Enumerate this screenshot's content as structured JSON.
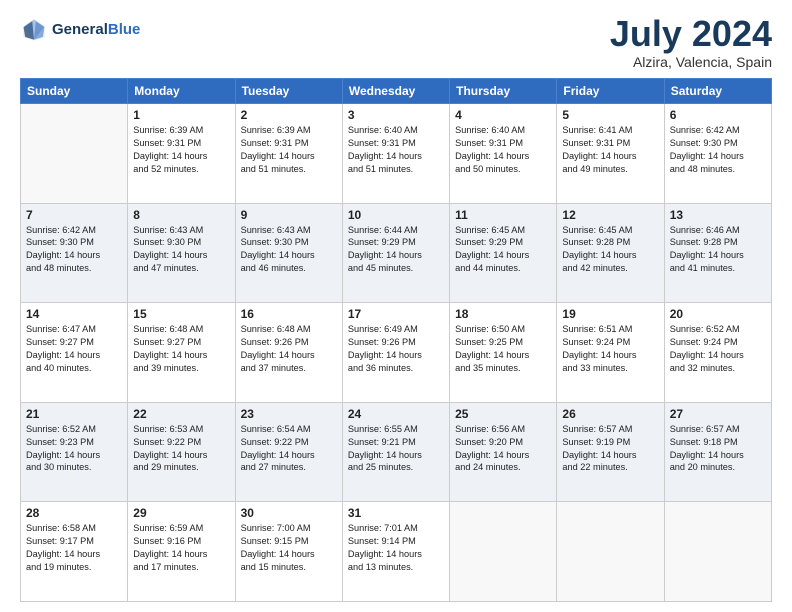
{
  "header": {
    "logo_line1": "General",
    "logo_line2": "Blue",
    "month_title": "July 2024",
    "location": "Alzira, Valencia, Spain"
  },
  "weekdays": [
    "Sunday",
    "Monday",
    "Tuesday",
    "Wednesday",
    "Thursday",
    "Friday",
    "Saturday"
  ],
  "weeks": [
    [
      {
        "day": "",
        "sunrise": "",
        "sunset": "",
        "daylight": ""
      },
      {
        "day": "1",
        "sunrise": "Sunrise: 6:39 AM",
        "sunset": "Sunset: 9:31 PM",
        "daylight": "Daylight: 14 hours and 52 minutes."
      },
      {
        "day": "2",
        "sunrise": "Sunrise: 6:39 AM",
        "sunset": "Sunset: 9:31 PM",
        "daylight": "Daylight: 14 hours and 51 minutes."
      },
      {
        "day": "3",
        "sunrise": "Sunrise: 6:40 AM",
        "sunset": "Sunset: 9:31 PM",
        "daylight": "Daylight: 14 hours and 51 minutes."
      },
      {
        "day": "4",
        "sunrise": "Sunrise: 6:40 AM",
        "sunset": "Sunset: 9:31 PM",
        "daylight": "Daylight: 14 hours and 50 minutes."
      },
      {
        "day": "5",
        "sunrise": "Sunrise: 6:41 AM",
        "sunset": "Sunset: 9:31 PM",
        "daylight": "Daylight: 14 hours and 49 minutes."
      },
      {
        "day": "6",
        "sunrise": "Sunrise: 6:42 AM",
        "sunset": "Sunset: 9:30 PM",
        "daylight": "Daylight: 14 hours and 48 minutes."
      }
    ],
    [
      {
        "day": "7",
        "sunrise": "Sunrise: 6:42 AM",
        "sunset": "Sunset: 9:30 PM",
        "daylight": "Daylight: 14 hours and 48 minutes."
      },
      {
        "day": "8",
        "sunrise": "Sunrise: 6:43 AM",
        "sunset": "Sunset: 9:30 PM",
        "daylight": "Daylight: 14 hours and 47 minutes."
      },
      {
        "day": "9",
        "sunrise": "Sunrise: 6:43 AM",
        "sunset": "Sunset: 9:30 PM",
        "daylight": "Daylight: 14 hours and 46 minutes."
      },
      {
        "day": "10",
        "sunrise": "Sunrise: 6:44 AM",
        "sunset": "Sunset: 9:29 PM",
        "daylight": "Daylight: 14 hours and 45 minutes."
      },
      {
        "day": "11",
        "sunrise": "Sunrise: 6:45 AM",
        "sunset": "Sunset: 9:29 PM",
        "daylight": "Daylight: 14 hours and 44 minutes."
      },
      {
        "day": "12",
        "sunrise": "Sunrise: 6:45 AM",
        "sunset": "Sunset: 9:28 PM",
        "daylight": "Daylight: 14 hours and 42 minutes."
      },
      {
        "day": "13",
        "sunrise": "Sunrise: 6:46 AM",
        "sunset": "Sunset: 9:28 PM",
        "daylight": "Daylight: 14 hours and 41 minutes."
      }
    ],
    [
      {
        "day": "14",
        "sunrise": "Sunrise: 6:47 AM",
        "sunset": "Sunset: 9:27 PM",
        "daylight": "Daylight: 14 hours and 40 minutes."
      },
      {
        "day": "15",
        "sunrise": "Sunrise: 6:48 AM",
        "sunset": "Sunset: 9:27 PM",
        "daylight": "Daylight: 14 hours and 39 minutes."
      },
      {
        "day": "16",
        "sunrise": "Sunrise: 6:48 AM",
        "sunset": "Sunset: 9:26 PM",
        "daylight": "Daylight: 14 hours and 37 minutes."
      },
      {
        "day": "17",
        "sunrise": "Sunrise: 6:49 AM",
        "sunset": "Sunset: 9:26 PM",
        "daylight": "Daylight: 14 hours and 36 minutes."
      },
      {
        "day": "18",
        "sunrise": "Sunrise: 6:50 AM",
        "sunset": "Sunset: 9:25 PM",
        "daylight": "Daylight: 14 hours and 35 minutes."
      },
      {
        "day": "19",
        "sunrise": "Sunrise: 6:51 AM",
        "sunset": "Sunset: 9:24 PM",
        "daylight": "Daylight: 14 hours and 33 minutes."
      },
      {
        "day": "20",
        "sunrise": "Sunrise: 6:52 AM",
        "sunset": "Sunset: 9:24 PM",
        "daylight": "Daylight: 14 hours and 32 minutes."
      }
    ],
    [
      {
        "day": "21",
        "sunrise": "Sunrise: 6:52 AM",
        "sunset": "Sunset: 9:23 PM",
        "daylight": "Daylight: 14 hours and 30 minutes."
      },
      {
        "day": "22",
        "sunrise": "Sunrise: 6:53 AM",
        "sunset": "Sunset: 9:22 PM",
        "daylight": "Daylight: 14 hours and 29 minutes."
      },
      {
        "day": "23",
        "sunrise": "Sunrise: 6:54 AM",
        "sunset": "Sunset: 9:22 PM",
        "daylight": "Daylight: 14 hours and 27 minutes."
      },
      {
        "day": "24",
        "sunrise": "Sunrise: 6:55 AM",
        "sunset": "Sunset: 9:21 PM",
        "daylight": "Daylight: 14 hours and 25 minutes."
      },
      {
        "day": "25",
        "sunrise": "Sunrise: 6:56 AM",
        "sunset": "Sunset: 9:20 PM",
        "daylight": "Daylight: 14 hours and 24 minutes."
      },
      {
        "day": "26",
        "sunrise": "Sunrise: 6:57 AM",
        "sunset": "Sunset: 9:19 PM",
        "daylight": "Daylight: 14 hours and 22 minutes."
      },
      {
        "day": "27",
        "sunrise": "Sunrise: 6:57 AM",
        "sunset": "Sunset: 9:18 PM",
        "daylight": "Daylight: 14 hours and 20 minutes."
      }
    ],
    [
      {
        "day": "28",
        "sunrise": "Sunrise: 6:58 AM",
        "sunset": "Sunset: 9:17 PM",
        "daylight": "Daylight: 14 hours and 19 minutes."
      },
      {
        "day": "29",
        "sunrise": "Sunrise: 6:59 AM",
        "sunset": "Sunset: 9:16 PM",
        "daylight": "Daylight: 14 hours and 17 minutes."
      },
      {
        "day": "30",
        "sunrise": "Sunrise: 7:00 AM",
        "sunset": "Sunset: 9:15 PM",
        "daylight": "Daylight: 14 hours and 15 minutes."
      },
      {
        "day": "31",
        "sunrise": "Sunrise: 7:01 AM",
        "sunset": "Sunset: 9:14 PM",
        "daylight": "Daylight: 14 hours and 13 minutes."
      },
      {
        "day": "",
        "sunrise": "",
        "sunset": "",
        "daylight": ""
      },
      {
        "day": "",
        "sunrise": "",
        "sunset": "",
        "daylight": ""
      },
      {
        "day": "",
        "sunrise": "",
        "sunset": "",
        "daylight": ""
      }
    ]
  ]
}
